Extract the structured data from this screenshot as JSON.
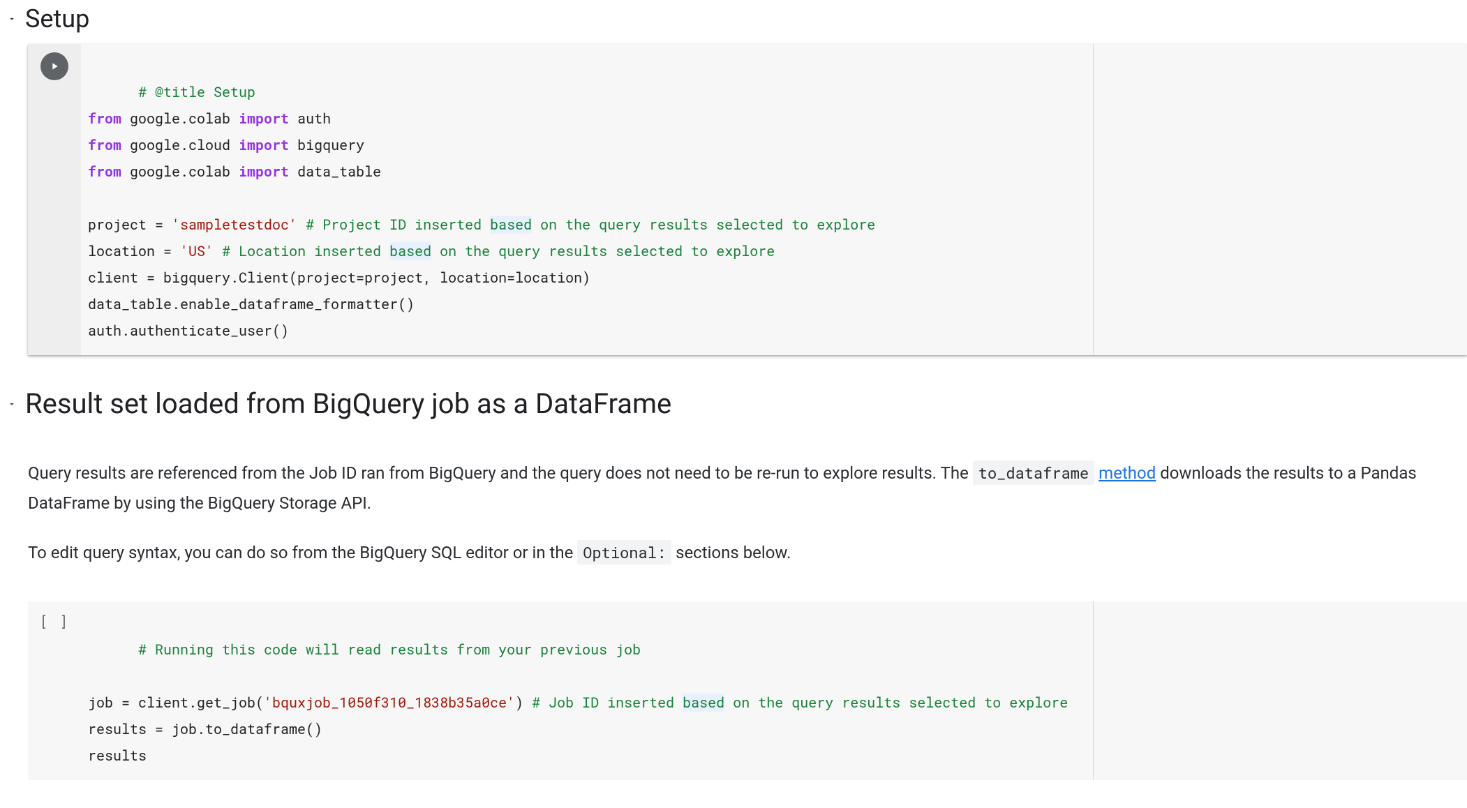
{
  "sections": {
    "setup": {
      "title": "Setup"
    },
    "result": {
      "title": "Result set loaded from BigQuery job as a DataFrame"
    }
  },
  "text": {
    "para1_a": "Query results are referenced from the Job ID ran from BigQuery and the query does not need to be re-run to explore results. The ",
    "para1_code": "to_dataframe",
    "para1_link": "method",
    "para1_b": " downloads the results to a Pandas DataFrame by using the BigQuery Storage API.",
    "para2_a": "To edit query syntax, you can do so from the BigQuery SQL editor or in the ",
    "para2_code": "Optional:",
    "para2_b": " sections below."
  },
  "code1": {
    "l1_comment": "# @title Setup",
    "l2_from": "from",
    "l2_mod": " google.colab ",
    "l2_import": "import",
    "l2_name": " auth",
    "l3_from": "from",
    "l3_mod": " google.cloud ",
    "l3_import": "import",
    "l3_name": " bigquery",
    "l4_from": "from",
    "l4_mod": " google.colab ",
    "l4_import": "import",
    "l4_name": " data_table",
    "l6_a": "project = ",
    "l6_str": "'sampletestdoc'",
    "l6_sp": " ",
    "l6_c1": "# Project ID inserted ",
    "l6_hl": "based",
    "l6_c2": " on the query results selected to explore",
    "l7_a": "location = ",
    "l7_str": "'US'",
    "l7_sp": " ",
    "l7_c1": "# Location inserted ",
    "l7_hl": "based",
    "l7_c2": " on the query results selected to explore",
    "l8": "client = bigquery.Client(project=project, location=location)",
    "l9": "data_table.enable_dataframe_formatter()",
    "l10": "auth.authenticate_user()"
  },
  "code2": {
    "exec_count": "[ ]",
    "l1_comment": "# Running this code will read results from your previous job",
    "l3_a": "job = client.get_job(",
    "l3_str": "'bquxjob_1050f310_1838b35a0ce'",
    "l3_b": ") ",
    "l3_c1": "# Job ID inserted ",
    "l3_hl": "based",
    "l3_c2": " on the query results selected to explore",
    "l4": "results = job.to_dataframe()",
    "l5": "results"
  }
}
